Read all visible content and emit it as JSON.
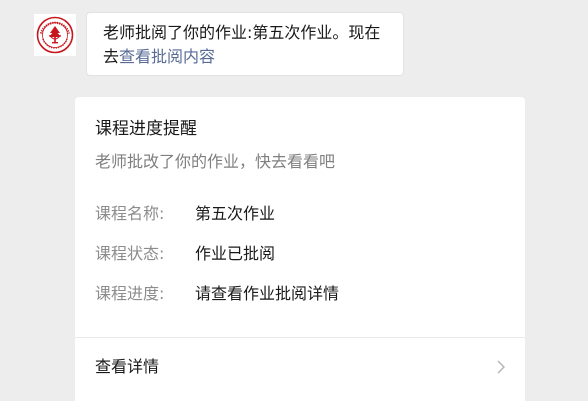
{
  "message": {
    "text_before_link": "老师批阅了你的作业:第五次作业。现在去",
    "link_text": "查看批阅内容"
  },
  "card": {
    "title": "课程进度提醒",
    "subtitle": "老师批改了你的作业，快去看看吧",
    "rows": [
      {
        "label": "课程名称:",
        "value": "第五次作业"
      },
      {
        "label": "课程状态:",
        "value": "作业已批阅"
      },
      {
        "label": "课程进度:",
        "value": "请查看作业批阅详情"
      }
    ],
    "footer_label": "查看详情"
  },
  "icons": {
    "avatar": "university-seal-icon",
    "chevron": "chevron-right-icon"
  },
  "colors": {
    "background": "#ededed",
    "link": "#576b95",
    "seal_red": "#c8161d"
  }
}
